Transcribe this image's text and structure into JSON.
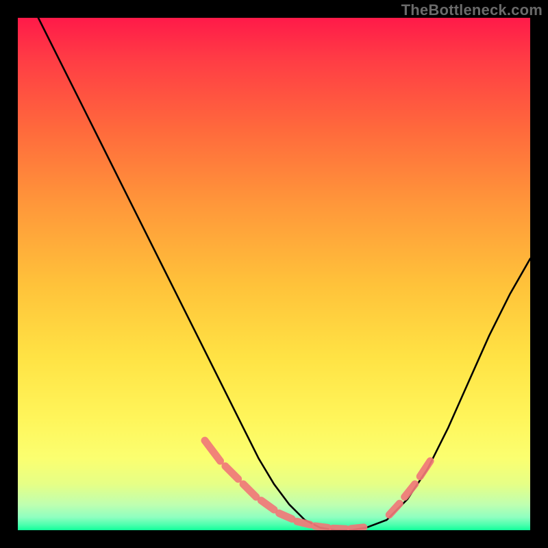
{
  "watermark": "TheBottleneck.com",
  "chart_data": {
    "type": "line",
    "title": "",
    "xlabel": "",
    "ylabel": "",
    "xlim": [
      0,
      100
    ],
    "ylim": [
      0,
      100
    ],
    "grid": false,
    "series": [
      {
        "name": "bottleneck-curve",
        "color": "#000000",
        "x": [
          4,
          8,
          12,
          16,
          20,
          24,
          28,
          32,
          36,
          40,
          44,
          47,
          50,
          53,
          56,
          59,
          62,
          65,
          68,
          72,
          76,
          80,
          84,
          88,
          92,
          96,
          100
        ],
        "y": [
          100,
          92,
          84,
          76,
          68,
          60,
          52,
          44,
          36,
          28,
          20,
          14,
          9,
          5,
          2,
          0.5,
          0,
          0,
          0.5,
          2,
          6,
          12,
          20,
          29,
          38,
          46,
          53
        ]
      },
      {
        "name": "highlight-dashes",
        "color": "#f07878",
        "segments": [
          {
            "x": [
              36.5,
              39.5
            ],
            "y": [
              17.5,
              13.5
            ]
          },
          {
            "x": [
              40.5,
              43.0
            ],
            "y": [
              12.5,
              10.0
            ]
          },
          {
            "x": [
              44.0,
              46.5
            ],
            "y": [
              9.0,
              6.5
            ]
          },
          {
            "x": [
              47.5,
              50.0
            ],
            "y": [
              5.8,
              4.0
            ]
          },
          {
            "x": [
              51.0,
              53.5
            ],
            "y": [
              3.3,
              2.2
            ]
          },
          {
            "x": [
              54.5,
              57.0
            ],
            "y": [
              1.7,
              1.1
            ]
          },
          {
            "x": [
              58.0,
              60.5
            ],
            "y": [
              0.8,
              0.5
            ]
          },
          {
            "x": [
              61.5,
              64.0
            ],
            "y": [
              0.35,
              0.25
            ]
          },
          {
            "x": [
              65.0,
              67.5
            ],
            "y": [
              0.3,
              0.55
            ]
          },
          {
            "x": [
              72.5,
              74.5
            ],
            "y": [
              3.0,
              5.2
            ]
          },
          {
            "x": [
              75.5,
              77.5
            ],
            "y": [
              6.5,
              9.0
            ]
          },
          {
            "x": [
              78.5,
              80.5
            ],
            "y": [
              10.5,
              13.5
            ]
          }
        ]
      }
    ]
  }
}
